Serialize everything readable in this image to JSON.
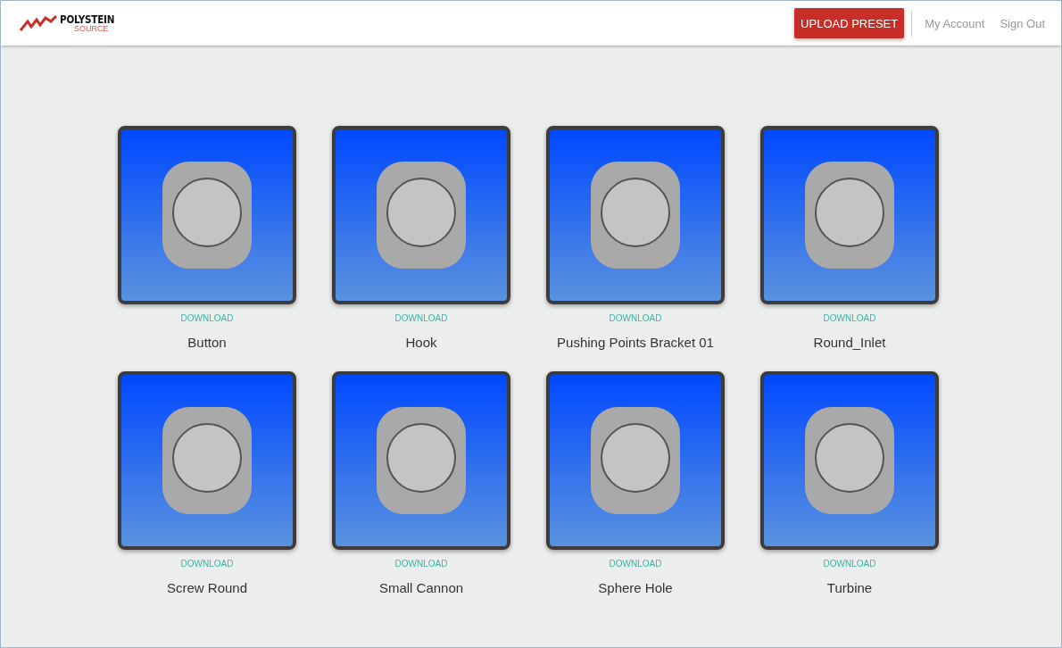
{
  "header": {
    "logo": {
      "name": "POLYSTEIN",
      "sub": "SOURCE"
    },
    "upload_button": "UPLOAD PRESET",
    "links": [
      "My Account",
      "Sign Out"
    ]
  },
  "presets": [
    {
      "name": "Button",
      "action": "DOWNLOAD"
    },
    {
      "name": "Hook",
      "action": "DOWNLOAD"
    },
    {
      "name": "Pushing Points Bracket 01",
      "action": "DOWNLOAD"
    },
    {
      "name": "Round_Inlet",
      "action": "DOWNLOAD"
    },
    {
      "name": "Screw Round",
      "action": "DOWNLOAD"
    },
    {
      "name": "Small Cannon",
      "action": "DOWNLOAD"
    },
    {
      "name": "Sphere Hole",
      "action": "DOWNLOAD"
    },
    {
      "name": "Turbine",
      "action": "DOWNLOAD"
    }
  ]
}
